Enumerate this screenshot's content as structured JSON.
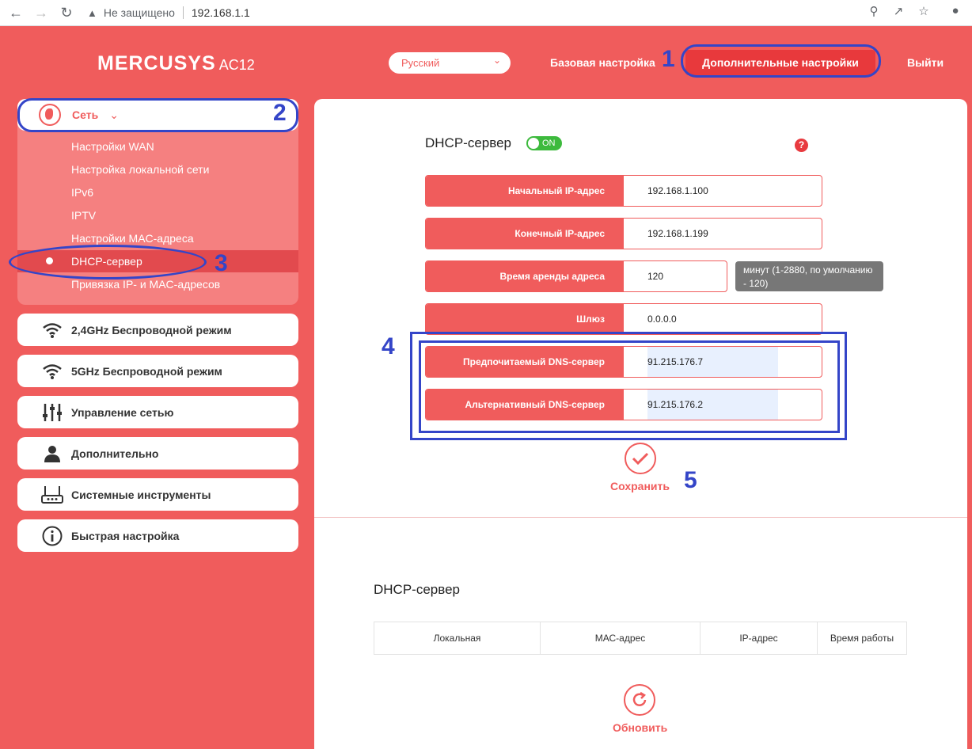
{
  "browser": {
    "security_label": "Не защищено",
    "url": "192.168.1.1"
  },
  "header": {
    "brand": "MERCUSYS",
    "model": "AC12",
    "language": "Русский",
    "basic_settings": "Базовая настройка",
    "advanced_settings": "Дополнительные настройки",
    "logout": "Выйти"
  },
  "annotations": [
    "1",
    "2",
    "3",
    "4",
    "5"
  ],
  "sidebar": {
    "network": {
      "label": "Сеть",
      "items": [
        "Настройки WAN",
        "Настройка локальной сети",
        "IPv6",
        "IPTV",
        "Настройки MAC-адреса",
        "DHCP-сервер",
        "Привязка IP- и MAC-адресов"
      ],
      "active_item": "DHCP-сервер"
    },
    "menu": [
      {
        "label": "2,4GHz Беспроводной режим",
        "icon": "wifi-icon"
      },
      {
        "label": "5GHz Беспроводной режим",
        "icon": "wifi-icon"
      },
      {
        "label": "Управление сетью",
        "icon": "sliders-icon"
      },
      {
        "label": "Дополнительно",
        "icon": "user-icon"
      },
      {
        "label": "Системные инструменты",
        "icon": "router-icon"
      },
      {
        "label": "Быстрая настройка",
        "icon": "info-icon"
      }
    ]
  },
  "dhcp": {
    "title": "DHCP-сервер",
    "toggle": "ON",
    "help": "?",
    "fields": [
      {
        "label": "Начальный IP-адрес",
        "value": "192.168.1.100"
      },
      {
        "label": "Конечный IP-адрес",
        "value": "192.168.1.199"
      },
      {
        "label": "Время аренды адреса",
        "value": "120"
      },
      {
        "label": "Шлюз",
        "value": "0.0.0.0"
      },
      {
        "label": "Предпочитаемый DNS-сервер",
        "value": "91.215.176.7"
      },
      {
        "label": "Альтернативный DNS-сервер",
        "value": "91.215.176.2"
      }
    ],
    "lease_hint": "минут (1-2880, по умолчанию - 120)",
    "save": "Сохранить"
  },
  "clients": {
    "title": "DHCP-сервер",
    "columns": [
      "Локальная",
      "МАС-адрес",
      "IP-адрес",
      "Время работы"
    ],
    "refresh": "Обновить"
  }
}
